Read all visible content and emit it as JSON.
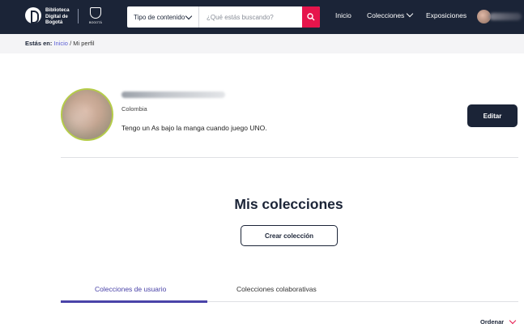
{
  "header": {
    "logo_line1": "Biblioteca",
    "logo_line2": "Digital de",
    "logo_line3": "Bogotá",
    "seal_text": "BOGOTÁ",
    "type_select": "Tipo de contenido",
    "search_placeholder": "¿Qué estás buscando?",
    "nav": [
      "Inicio",
      "Colecciones",
      "Exposiciones"
    ],
    "colors": {
      "bar": "#1b2437",
      "search_button": "#e6154c"
    }
  },
  "breadcrumb": {
    "prefix": "Estás en:",
    "home": "Inicio",
    "separator": "/",
    "current": "Mi perfil"
  },
  "profile": {
    "country": "Colombia",
    "bio": "Tengo un As bajo la manga cuando juego UNO.",
    "edit_label": "Editar"
  },
  "collections": {
    "title": "Mis colecciones",
    "create_label": "Crear colección",
    "tabs": [
      {
        "label": "Colecciones de usuario",
        "active": true
      },
      {
        "label": "Colecciones colaborativas",
        "active": false
      }
    ],
    "sort_label": "Ordenar",
    "accent": "#4a43a8"
  },
  "icons": {
    "logo": "bdb-logo-icon",
    "seal": "bogota-seal-icon",
    "search": "search-icon",
    "chevron": "chevron-down-icon"
  }
}
